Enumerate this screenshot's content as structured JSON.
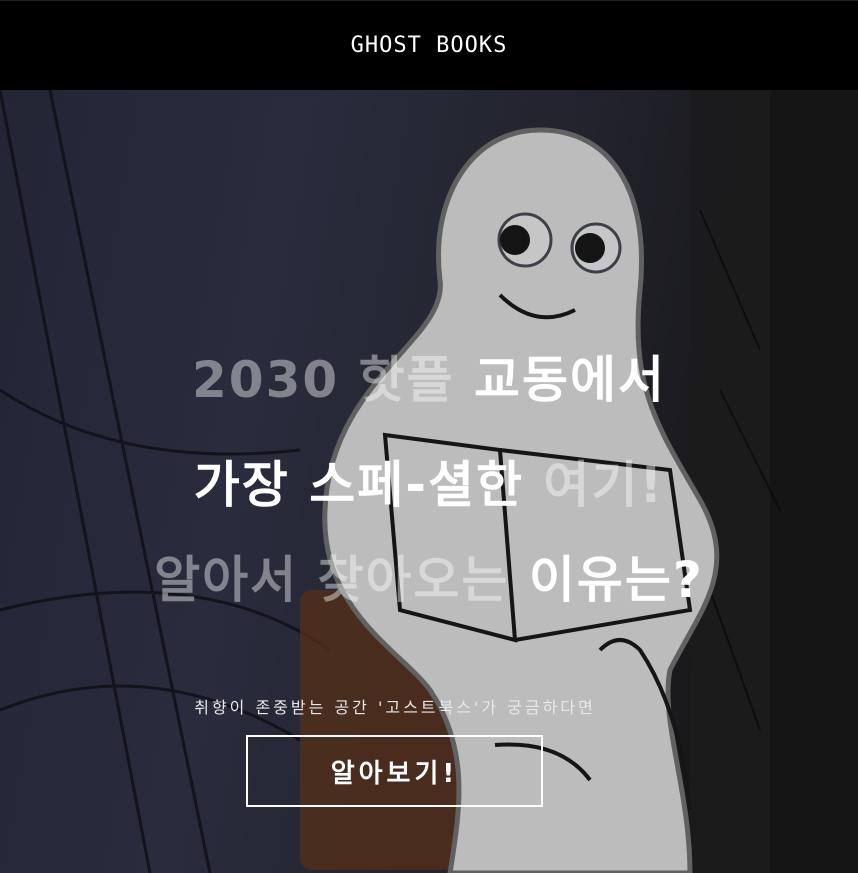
{
  "header": {
    "logo_text": "GHOST BOOKS"
  },
  "hero": {
    "line1": {
      "dim": "2030 핫플 ",
      "bright": "교동에서"
    },
    "line2": {
      "bright": "가장 스페-셜한 ",
      "dim": "여기!"
    },
    "line3": {
      "dim": "알아서 찾아오는 ",
      "bright": "이유는?"
    },
    "subtitle": "취향이 존중받는 공간 '고스트북스'가 궁금하다면",
    "cta_label": "알아보기!"
  },
  "colors": {
    "header_bg": "#000000",
    "hero_bg": "#2b2e42",
    "text": "#ffffff",
    "ghost": "#e6e6e6"
  },
  "icons": [
    "ghost-mascot-illustration"
  ]
}
